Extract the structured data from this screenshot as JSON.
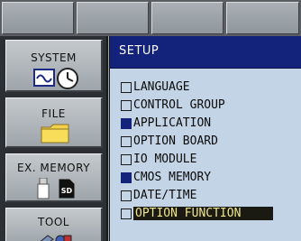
{
  "top_keys": [
    "",
    "",
    "",
    ""
  ],
  "sidebar": {
    "items": [
      {
        "label": "SYSTEM",
        "icon": "system-clock-icon"
      },
      {
        "label": "FILE",
        "icon": "folder-icon"
      },
      {
        "label": "EX. MEMORY",
        "icon": "sd-card-icon"
      },
      {
        "label": "TOOL",
        "icon": "tool-icon"
      }
    ]
  },
  "setup": {
    "title": "SETUP",
    "items": [
      {
        "label": "LANGUAGE",
        "checked": false
      },
      {
        "label": "CONTROL GROUP",
        "checked": false
      },
      {
        "label": "APPLICATION",
        "checked": true
      },
      {
        "label": "OPTION BOARD",
        "checked": false
      },
      {
        "label": "IO MODULE",
        "checked": false
      },
      {
        "label": "CMOS MEMORY",
        "checked": true
      },
      {
        "label": "DATE/TIME",
        "checked": false
      },
      {
        "label": "OPTION FUNCTION",
        "checked": false,
        "selected": true
      }
    ]
  },
  "colors": {
    "header_blue": "#13227a",
    "panel_blue": "#c3d4e6",
    "selected_bg": "#1a1a12",
    "selected_text": "#f0e68c"
  }
}
